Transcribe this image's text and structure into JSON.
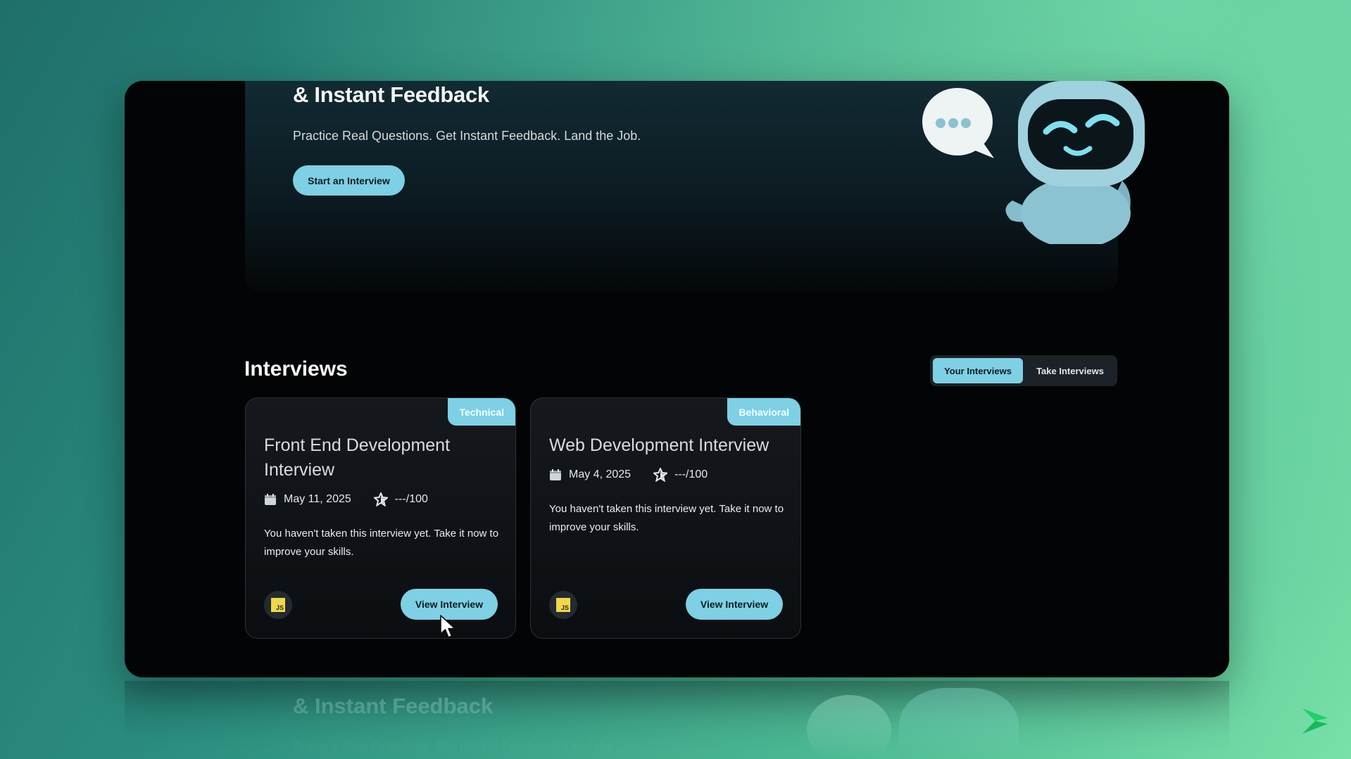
{
  "hero": {
    "title": "& Instant Feedback",
    "subtitle": "Practice Real Questions. Get Instant Feedback. Land the Job.",
    "cta_label": "Start an Interview"
  },
  "interviews": {
    "title": "Interviews",
    "tabs": [
      {
        "label": "Your Interviews",
        "active": true
      },
      {
        "label": "Take Interviews",
        "active": false
      }
    ],
    "cards": [
      {
        "badge": "Technical",
        "title": "Front End Development Interview",
        "date": "May 11, 2025",
        "score": "---/100",
        "description": "You haven't taken this interview yet. Take it now to improve your skills.",
        "tech_icon": "JS",
        "button_label": "View Interview"
      },
      {
        "badge": "Behavioral",
        "title": "Web Development Interview",
        "date": "May 4, 2025",
        "score": "---/100",
        "description": "You haven't taken this interview yet. Take it now to improve your skills.",
        "tech_icon": "JS",
        "button_label": "View Interview"
      }
    ]
  },
  "reflection": {
    "title": "& Instant Feedback",
    "subtitle": "Practice Real Questions. Get Instant Feedback. Land the Job."
  },
  "colors": {
    "accent": "#7ed0e4",
    "background": "#030405",
    "card": "#15191d"
  },
  "icons": [
    "calendar-icon",
    "star-icon",
    "js-icon",
    "robot-mascot",
    "speech-bubble-icon",
    "cursor-icon",
    "brand-logo-icon"
  ]
}
